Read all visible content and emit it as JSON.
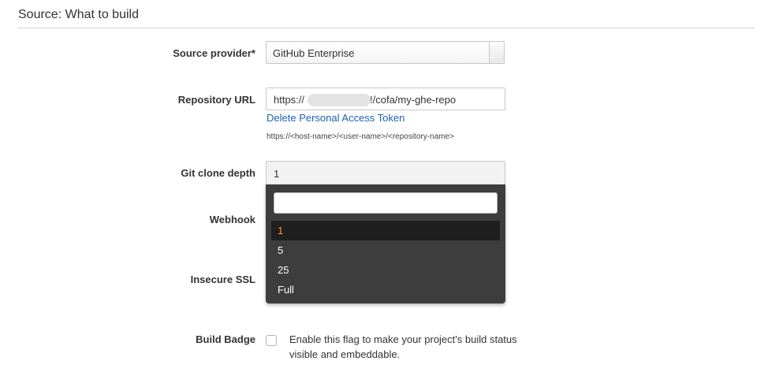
{
  "section": {
    "title": "Source: What to build"
  },
  "source_provider": {
    "label": "Source provider*",
    "value": "GitHub Enterprise"
  },
  "repository_url": {
    "label": "Repository URL",
    "prefix": "https://",
    "suffix": "!/cofa/my-ghe-repo",
    "link": "Delete Personal Access Token",
    "hint": "https://<host-name>/<user-name>/<repository-name>"
  },
  "git_clone_depth": {
    "label": "Git clone depth",
    "value": "1",
    "search_value": "",
    "options": [
      "1",
      "5",
      "25",
      "Full"
    ],
    "selected_color": "#ff9a1a"
  },
  "webhook": {
    "label": "Webhook"
  },
  "insecure_ssl": {
    "label": "Insecure SSL"
  },
  "build_badge": {
    "label": "Build Badge",
    "checked": false,
    "description": "Enable this flag to make your project's build status visible and embeddable."
  }
}
